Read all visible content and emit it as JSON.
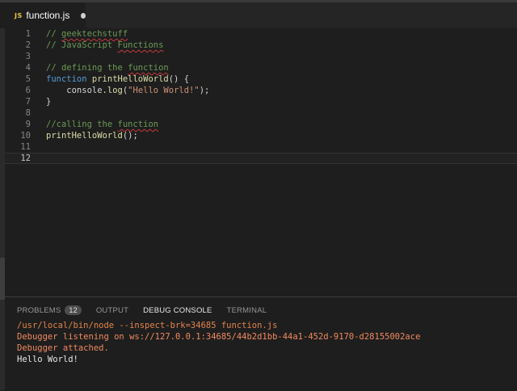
{
  "tab": {
    "icon": "JS",
    "filename": "function.js"
  },
  "editor": {
    "lines": [
      {
        "n": "1",
        "parts": [
          {
            "t": "// ",
            "c": "comment"
          },
          {
            "t": "geektechstuff",
            "c": "comment sq"
          }
        ]
      },
      {
        "n": "2",
        "parts": [
          {
            "t": "// JavaScript ",
            "c": "comment"
          },
          {
            "t": "Functions",
            "c": "comment sq"
          }
        ]
      },
      {
        "n": "3",
        "parts": []
      },
      {
        "n": "4",
        "parts": [
          {
            "t": "// defining the ",
            "c": "comment"
          },
          {
            "t": "function",
            "c": "comment sq"
          }
        ]
      },
      {
        "n": "5",
        "parts": [
          {
            "t": "function ",
            "c": "kw"
          },
          {
            "t": "printHelloWorld",
            "c": "fn"
          },
          {
            "t": "() {",
            "c": "plain"
          }
        ]
      },
      {
        "n": "6",
        "parts": [
          {
            "t": "    console",
            "c": "plain"
          },
          {
            "t": ".log",
            "c": "fn"
          },
          {
            "t": "(",
            "c": "plain"
          },
          {
            "t": "\"Hello World!\"",
            "c": "str"
          },
          {
            "t": ");",
            "c": "plain"
          }
        ]
      },
      {
        "n": "7",
        "parts": [
          {
            "t": "}",
            "c": "plain"
          }
        ]
      },
      {
        "n": "8",
        "parts": []
      },
      {
        "n": "9",
        "parts": [
          {
            "t": "//calling the ",
            "c": "comment"
          },
          {
            "t": "function",
            "c": "comment sq"
          }
        ]
      },
      {
        "n": "10",
        "parts": [
          {
            "t": "printHelloWorld",
            "c": "fn"
          },
          {
            "t": "();",
            "c": "plain"
          }
        ]
      },
      {
        "n": "11",
        "parts": []
      },
      {
        "n": "12",
        "parts": []
      }
    ],
    "current_line": "12"
  },
  "panel": {
    "tabs": [
      {
        "label": "PROBLEMS",
        "badge": "12"
      },
      {
        "label": "OUTPUT"
      },
      {
        "label": "DEBUG CONSOLE"
      },
      {
        "label": "TERMINAL"
      }
    ],
    "active_tab": "DEBUG CONSOLE",
    "console": [
      {
        "text": "/usr/local/bin/node --inspect-brk=34685 function.js",
        "c": "c-orange"
      },
      {
        "text": "Debugger listening on ws://127.0.0.1:34685/44b2d1bb-44a1-452d-9170-d28155002ace",
        "c": "c-red"
      },
      {
        "text": "Debugger attached.",
        "c": "c-red"
      },
      {
        "text": "Hello World!",
        "c": "c-white"
      }
    ]
  },
  "colors": {
    "background": "#1e1e1e",
    "comment": "#6a9955",
    "keyword": "#569cd6",
    "function": "#dcdcaa",
    "string": "#ce9178"
  }
}
